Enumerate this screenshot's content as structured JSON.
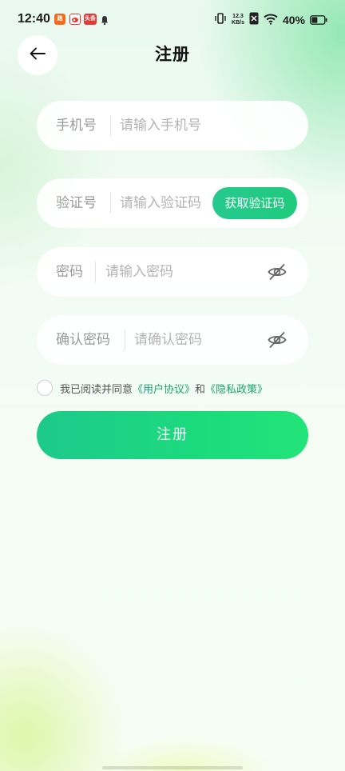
{
  "status_bar": {
    "time": "12:40",
    "notif_1": "跑",
    "notif_3": "头条",
    "net_speed_value": "12.3",
    "net_speed_unit": "KB/s",
    "battery": "40%"
  },
  "header": {
    "title": "注册"
  },
  "form": {
    "phone": {
      "label": "手机号",
      "placeholder": "请输入手机号"
    },
    "code": {
      "label": "验证号",
      "placeholder": "请输入验证码",
      "button": "获取验证码"
    },
    "password": {
      "label": "密码",
      "placeholder": "请输入密码"
    },
    "confirm": {
      "label": "确认密码",
      "placeholder": "请确认密码"
    }
  },
  "agreement": {
    "prefix": "我已阅读并同意",
    "user_agreement": "《用户协议》",
    "and": "和",
    "privacy_policy": "《隐私政策》",
    "checked": false
  },
  "register_button": "注册",
  "colors": {
    "accent": "#1dc98b",
    "link": "#1aa56f"
  }
}
